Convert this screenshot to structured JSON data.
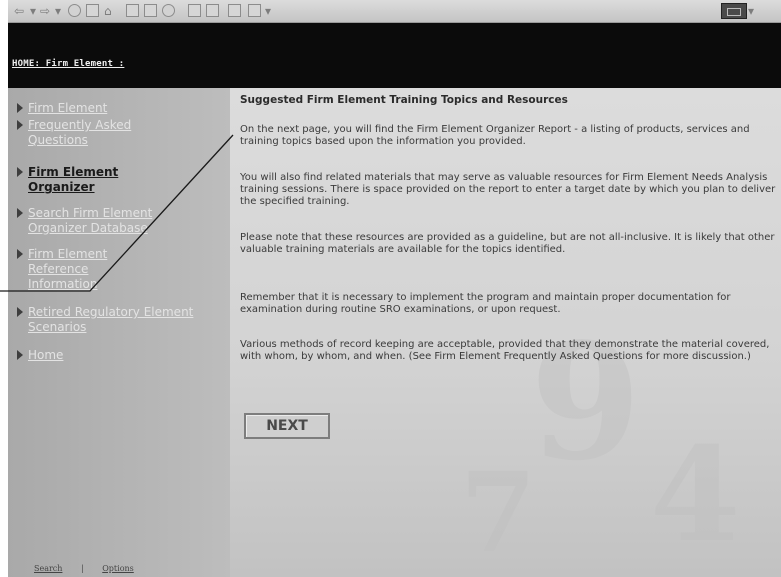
{
  "header": {
    "home_link": "HOME: Firm Element :"
  },
  "sidebar": {
    "items": [
      {
        "label": "Firm Element"
      },
      {
        "label": "Frequently Asked Questions"
      },
      {
        "label": "Firm Element Organizer"
      },
      {
        "label": "Search Firm Element Organizer Database"
      },
      {
        "label": "Firm Element Reference Information"
      },
      {
        "label": "Retired Regulatory Element Scenarios"
      },
      {
        "label": "Home"
      }
    ],
    "footer": {
      "search": "Search",
      "separator": "|",
      "options": "Options"
    }
  },
  "main": {
    "title": "Suggested Firm Element Training Topics and Resources",
    "paragraphs": [
      "On the next page, you will find the Firm Element Organizer Report - a listing of products, services and training topics based upon the information you provided.",
      "You will also find related materials that may serve as valuable resources for Firm Element Needs Analysis training sessions. There is space provided on the report to enter a target date by which you plan to deliver the specified training.",
      "Please note that these resources are provided as a guideline, but are not all-inclusive. It is likely that other valuable training materials are available for the topics identified.",
      "Remember that it is necessary to implement the program and maintain proper documentation for examination during routine SRO examinations, or upon request.",
      "Various methods of record keeping are acceptable, provided that they demonstrate the material covered, with whom, by whom, and when. (See Firm Element Frequently Asked Questions for more discussion.)"
    ],
    "next_label": "NEXT"
  },
  "icons": [
    "back-icon",
    "forward-icon",
    "stop-icon",
    "refresh-icon",
    "home-icon",
    "search-icon",
    "favorites-icon",
    "history-icon",
    "mail-icon",
    "print-icon",
    "edit-icon",
    "discuss-icon",
    "windows-logo-icon"
  ]
}
